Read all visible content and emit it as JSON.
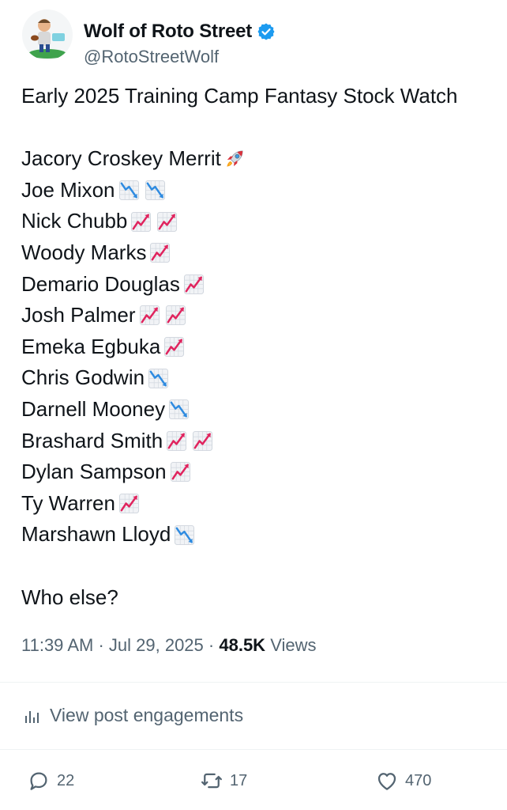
{
  "author": {
    "display_name": "Wolf of Roto Street",
    "handle": "@RotoStreetWolf",
    "verified": true,
    "avatar_icon": "cartoon-football-player-avatar"
  },
  "post": {
    "title": "Early 2025 Training Camp Fantasy Stock Watch",
    "players": [
      {
        "name": "Jacory Croskey Merrit",
        "icons": [
          "rocket-emoji"
        ]
      },
      {
        "name": "Joe Mixon",
        "icons": [
          "chart-decreasing-emoji",
          "chart-decreasing-emoji"
        ]
      },
      {
        "name": "Nick Chubb",
        "icons": [
          "chart-increasing-emoji",
          "chart-increasing-emoji"
        ]
      },
      {
        "name": "Woody Marks",
        "icons": [
          "chart-increasing-emoji"
        ]
      },
      {
        "name": "Demario Douglas",
        "icons": [
          "chart-increasing-emoji"
        ]
      },
      {
        "name": "Josh Palmer",
        "icons": [
          "chart-increasing-emoji",
          "chart-increasing-emoji"
        ]
      },
      {
        "name": "Emeka Egbuka",
        "icons": [
          "chart-increasing-emoji"
        ]
      },
      {
        "name": "Chris Godwin",
        "icons": [
          "chart-decreasing-emoji"
        ]
      },
      {
        "name": "Darnell Mooney",
        "icons": [
          "chart-decreasing-emoji"
        ]
      },
      {
        "name": "Brashard Smith",
        "icons": [
          "chart-increasing-emoji",
          "chart-increasing-emoji"
        ]
      },
      {
        "name": "Dylan Sampson",
        "icons": [
          "chart-increasing-emoji"
        ]
      },
      {
        "name": "Ty Warren",
        "icons": [
          "chart-increasing-emoji"
        ]
      },
      {
        "name": "Marshawn Lloyd",
        "icons": [
          "chart-decreasing-emoji"
        ]
      }
    ],
    "closing": "Who else?"
  },
  "meta": {
    "time": "11:39 AM",
    "separator": "·",
    "date": "Jul 29, 2025",
    "views_count": "48.5K",
    "views_label": "Views"
  },
  "engagements": {
    "label": "View post engagements",
    "icon": "bar-chart-icon"
  },
  "actions": {
    "replies": "22",
    "reposts": "17",
    "likes": "470"
  },
  "colors": {
    "text": "#0f1419",
    "secondary": "#536471",
    "verified_blue": "#1d9bf0",
    "up_red": "#e0245e",
    "down_blue": "#2f8be0"
  }
}
